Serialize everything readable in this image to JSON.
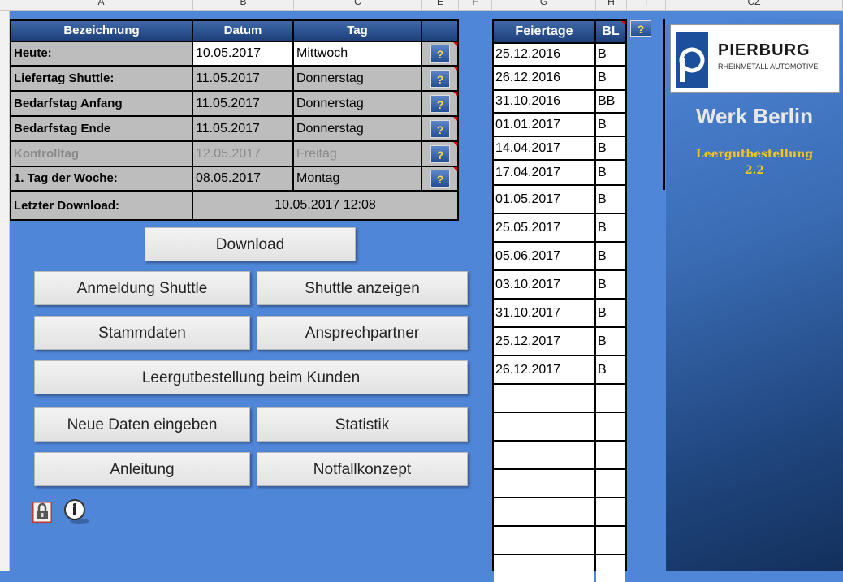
{
  "column_headers": [
    "A",
    "B",
    "C",
    "E",
    "F",
    "G",
    "H",
    "I",
    "CZ"
  ],
  "info_table": {
    "headers": {
      "bezeichnung": "Bezeichnung",
      "datum": "Datum",
      "tag": "Tag"
    },
    "rows": [
      {
        "label": "Heute:",
        "datum": "10.05.2017",
        "tag": "Mittwoch",
        "help": "?"
      },
      {
        "label": "Liefertag Shuttle:",
        "datum": "11.05.2017",
        "tag": "Donnerstag",
        "help": "?"
      },
      {
        "label": "Bedarfstag Anfang",
        "datum": "11.05.2017",
        "tag": "Donnerstag",
        "help": "?"
      },
      {
        "label": "Bedarfstag Ende",
        "datum": "11.05.2017",
        "tag": "Donnerstag",
        "help": "?"
      },
      {
        "label": "Kontrolltag",
        "datum": "12.05.2017",
        "tag": "Freitag",
        "help": "?"
      },
      {
        "label": "1. Tag der Woche:",
        "datum": "08.05.2017",
        "tag": "Montag",
        "help": "?"
      }
    ],
    "last_download_label": "Letzter Download:",
    "last_download_value": "10.05.2017 12:08"
  },
  "buttons": {
    "download": "Download",
    "anmeldung_shuttle": "Anmeldung Shuttle",
    "shuttle_anzeigen": "Shuttle anzeigen",
    "stammdaten": "Stammdaten",
    "ansprechpartner": "Ansprechpartner",
    "leergutbestellung": "Leergutbestellung beim Kunden",
    "neue_daten": "Neue Daten eingeben",
    "statistik": "Statistik",
    "anleitung": "Anleitung",
    "notfallkonzept": "Notfallkonzept"
  },
  "icons": {
    "lock": "lock-icon",
    "info": "info-icon"
  },
  "holidays": {
    "header_feiertage": "Feiertage",
    "header_bl": "BL",
    "help": "?",
    "rows": [
      {
        "date": "25.12.2016",
        "bl": "B"
      },
      {
        "date": "26.12.2016",
        "bl": "B"
      },
      {
        "date": "31.10.2016",
        "bl": "BB"
      },
      {
        "date": "01.01.2017",
        "bl": "B"
      },
      {
        "date": "14.04.2017",
        "bl": "B"
      },
      {
        "date": "17.04.2017",
        "bl": "B"
      },
      {
        "date": "01.05.2017",
        "bl": "B"
      },
      {
        "date": "25.05.2017",
        "bl": "B"
      },
      {
        "date": "05.06.2017",
        "bl": "B"
      },
      {
        "date": "03.10.2017",
        "bl": "B"
      },
      {
        "date": "31.10.2017",
        "bl": "B"
      },
      {
        "date": "25.12.2017",
        "bl": "B"
      },
      {
        "date": "26.12.2017",
        "bl": "B"
      }
    ]
  },
  "logo": {
    "name": "PIERBURG",
    "subtitle": "RHEINMETALL AUTOMOTIVE"
  },
  "plant": {
    "title": "Werk Berlin",
    "app_name": "Leergutbestellung",
    "version": "2.2"
  },
  "colors": {
    "sheet_blue": "#4f86d8",
    "header_blue": "#1d3f79",
    "accent_yellow": "#f5c518"
  }
}
